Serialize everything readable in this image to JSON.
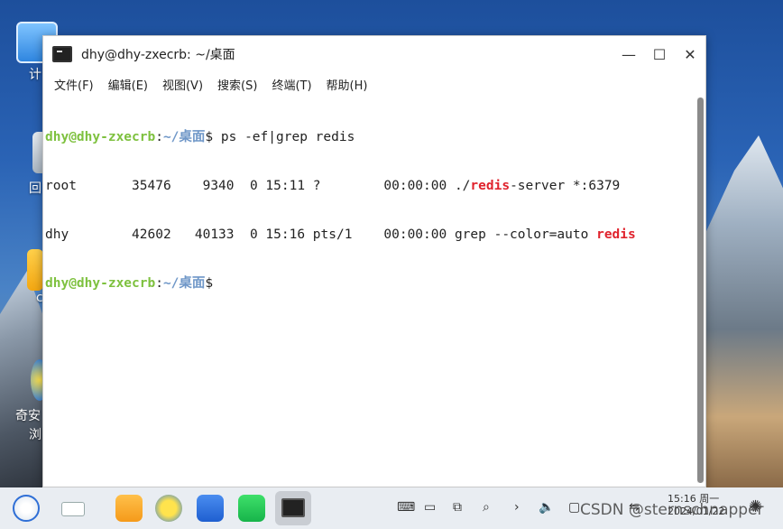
{
  "window": {
    "title": "dhy@dhy-zxecrb: ~/桌面",
    "minimize_glyph": "—",
    "maximize_glyph": "☐",
    "close_glyph": "✕"
  },
  "menu": {
    "items": [
      {
        "label": "文件(F)"
      },
      {
        "label": "编辑(E)"
      },
      {
        "label": "视图(V)"
      },
      {
        "label": "搜索(S)"
      },
      {
        "label": "终端(T)"
      },
      {
        "label": "帮助(H)"
      }
    ]
  },
  "terminal": {
    "line1": {
      "user": "dhy@dhy-zxecrb",
      "colon": ":",
      "path": "~/桌面",
      "prompt": "$ ",
      "cmd": "ps -ef|grep redis"
    },
    "line2": {
      "pre": "root       35476    9340  0 15:11 ?        00:00:00 ./",
      "hl": "redis",
      "post": "-server *:6379"
    },
    "line3": {
      "pre": "dhy        42602   40133  0 15:16 pts/1    00:00:00 grep --color=auto ",
      "hl": "redis",
      "post": ""
    },
    "line4": {
      "user": "dhy@dhy-zxecrb",
      "colon": ":",
      "path": "~/桌面",
      "prompt": "$ "
    }
  },
  "desktop": {
    "labels": [
      "计",
      "回",
      "c",
      "奇安",
      "浏"
    ]
  },
  "taskbar": {
    "clock_time": "15:16 周一",
    "clock_date": "2024/01/22",
    "watermark": "CSDN @sternschnapper"
  },
  "colors": {
    "prompt_user": "#7ec13f",
    "prompt_path": "#6f97c8",
    "match_highlight": "#e0232d"
  }
}
